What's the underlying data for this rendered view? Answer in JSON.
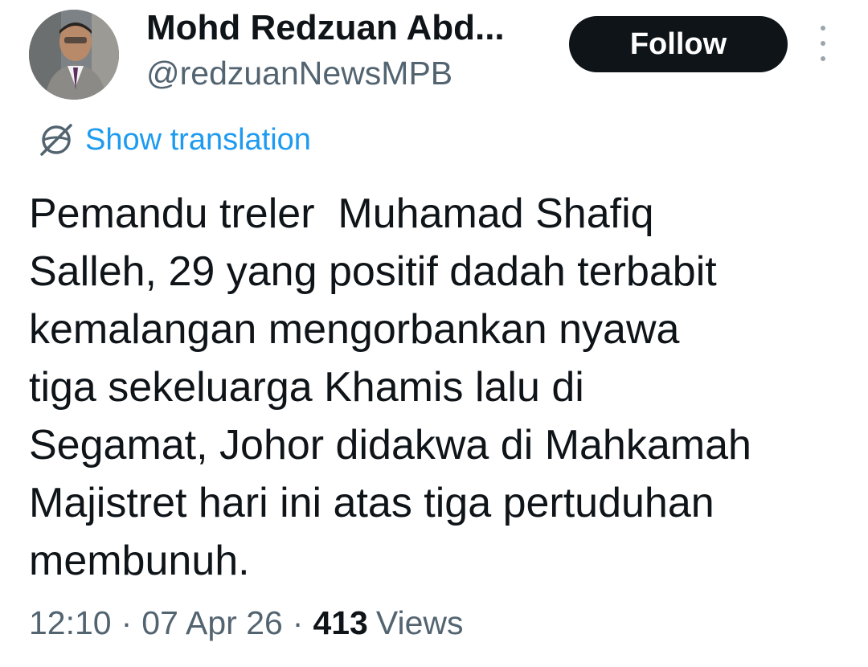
{
  "author": {
    "name": "Mohd Redzuan Abd...",
    "handle": "@redzuanNewsMPB",
    "avatar_icon": "profile-photo-avatar"
  },
  "actions": {
    "follow_label": "Follow",
    "more_icon": "vertical-ellipsis-icon"
  },
  "translation": {
    "label": "Show translation",
    "icon": "globe-slash-icon"
  },
  "tweet": {
    "text": "Pemandu treler  Muhamad Shafiq\nSalleh, 29 yang positif dadah terbabit\nkemalangan mengorbankan nyawa\ntiga sekeluarga Khamis lalu di\nSegamat, Johor didakwa di Mahkamah\nMajistret hari ini atas tiga pertuduhan\nmembunuh."
  },
  "meta": {
    "time": "12:10",
    "separator": "·",
    "date": "07 Apr 26",
    "views_count": "413",
    "views_label": "Views"
  },
  "colors": {
    "text_primary": "#0f1419",
    "text_secondary": "#536471",
    "link_blue": "#1d9bf0",
    "button_dark": "#0f1419"
  }
}
